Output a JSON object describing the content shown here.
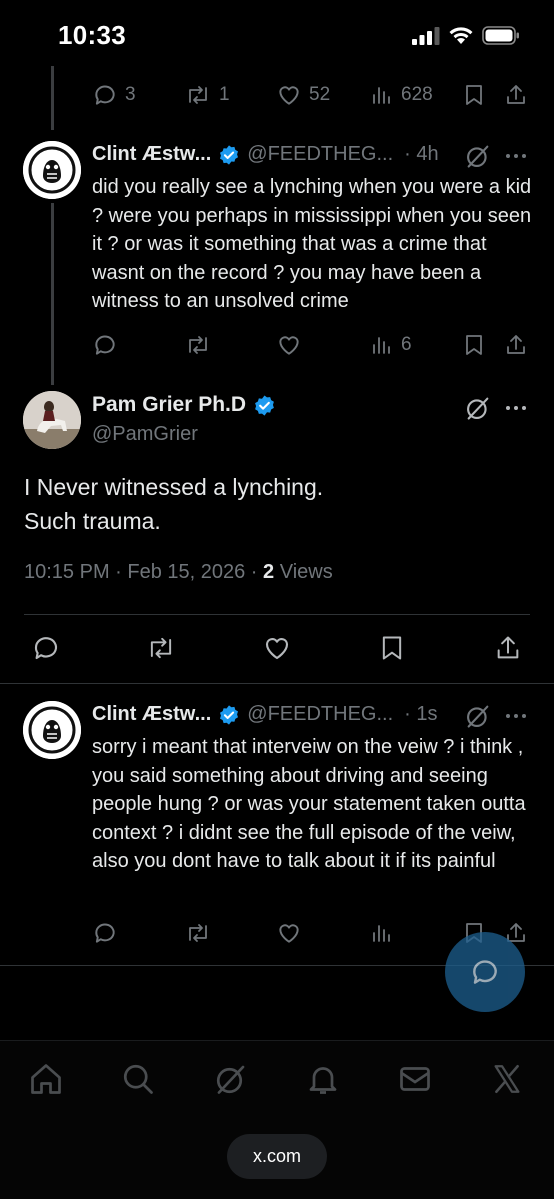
{
  "status_bar": {
    "time": "10:33"
  },
  "top_tweet_actions": {
    "replies": "3",
    "reposts": "1",
    "likes": "52",
    "views": "628"
  },
  "reply1": {
    "name": "Clint Æstw...",
    "handle": "@FEEDTHEG...",
    "time": "· 4h",
    "text": "did you really see a lynching when you were a kid ? were you perhaps in mississippi when you seen it ? or was it something that was a crime that wasnt on the record ? you may have been a witness to an unsolved crime",
    "views": "6"
  },
  "main_tweet": {
    "name": "Pam Grier Ph.D",
    "handle": "@PamGrier",
    "text_line1": "I Never witnessed a lynching.",
    "text_line2": "Such trauma.",
    "timestamp": "10:15 PM · Feb 15, 2026 · ",
    "views_count": "2",
    "views_label": " Views"
  },
  "reply2": {
    "name": "Clint Æstw...",
    "handle": "@FEEDTHEG...",
    "time": "· 1s",
    "text": "sorry i meant that interveiw on the veiw ? i think , you said something about driving and seeing people hung ? or was your statement taken outta context ? i didnt see the full episode of the veiw, also you dont have to talk about it if its painful"
  },
  "browser": {
    "url": "x.com"
  },
  "colors": {
    "background": "#000000",
    "text": "#e7e9ea",
    "muted": "#71767b",
    "verified": "#1d9bf0",
    "divider": "#2f3336"
  },
  "icons": [
    "reply-icon",
    "repost-icon",
    "like-icon",
    "views-icon",
    "bookmark-icon",
    "share-icon",
    "grok-icon",
    "more-icon",
    "verified-icon",
    "home-icon",
    "search-icon",
    "notifications-icon",
    "messages-icon",
    "x-logo-icon",
    "compose-reply-icon"
  ]
}
